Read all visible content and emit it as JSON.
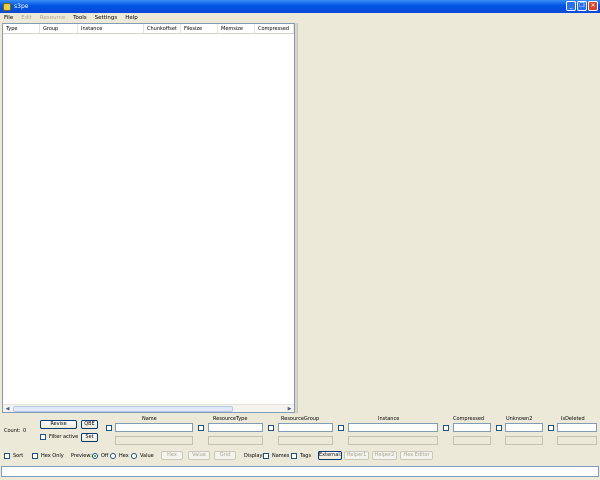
{
  "window": {
    "title": "s3pe"
  },
  "menu": [
    {
      "label": "File",
      "enabled": true
    },
    {
      "label": "Edit",
      "enabled": false
    },
    {
      "label": "Resource",
      "enabled": false
    },
    {
      "label": "Tools",
      "enabled": true
    },
    {
      "label": "Settings",
      "enabled": true
    },
    {
      "label": "Help",
      "enabled": true
    }
  ],
  "list": {
    "columns": [
      "Type",
      "Group",
      "Instance",
      "Chunkoffset",
      "Filesize",
      "Memsize",
      "Compressed"
    ]
  },
  "filter": {
    "count_label": "Count:",
    "count_value": "0",
    "revise_label": "Revise",
    "qbe_label": "QBE",
    "filter_active_label": "Filter active",
    "set_label": "Set",
    "fields": [
      "Name",
      "ResourceType",
      "ResourceGroup",
      "Instance",
      "Compressed",
      "Unknown2",
      "IsDeleted"
    ]
  },
  "options": {
    "sort_label": "Sort",
    "hex_only_label": "Hex Only",
    "preview_label": "Preview:",
    "preview_off": "Off",
    "preview_hex": "Hex",
    "preview_value": "Value",
    "preview_selected": "Off",
    "hex_button": "Hex",
    "value_button": "Value",
    "grid_button": "Grid",
    "display_label": "Display:",
    "names_label": "Names",
    "tags_label": "Tags",
    "external_label": "External:",
    "helper1": "Helper1",
    "helper2": "Helper2",
    "hex_editor": "Hex Editor"
  }
}
